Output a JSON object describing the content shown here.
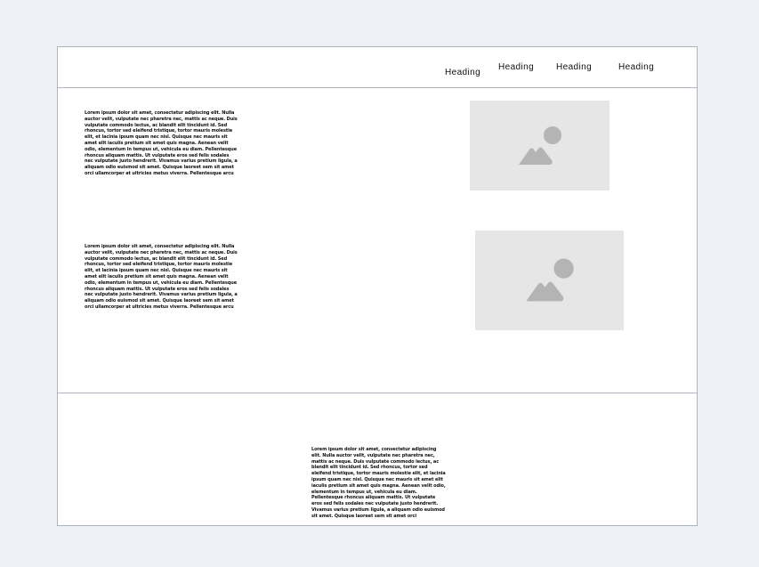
{
  "header": {
    "headings": [
      "Heading",
      "Heading",
      "Heading",
      "Heading"
    ]
  },
  "content": {
    "paragraph_1": "Lorem ipsum dolor sit amet, consectetur adipiscing elit. Nulla auctor velit, vulputate nec pharetra nec, mattis ac neque. Duis vulputate commodo lectus, ac blandit elit tincidunt id. Sed rhoncus, tortor sed eleifend tristique, tortor mauris molestie elit, et lacinia ipsum quam nec nisl. Quisque nec mauris sit amet elit iaculis pretium sit amet quis magna. Aenean velit odio, elementum in tempus ut, vehicula eu diam. Pellentesque rhoncus aliquam mattis. Ut vulputate eros sed felis sodales nec vulputate justo hendrerit. Vivamus varius pretium ligula, a aliquam odio euismod sit amet. Quisque laoreet sem sit amet orci ullamcorper at ultricies metus viverra. Pellentesque arcu mauris, malesuada quis ornare accumsan, blandit sed diam.",
    "paragraph_2": "Lorem ipsum dolor sit amet, consectetur adipiscing elit. Nulla auctor velit, vulputate nec pharetra nec, mattis ac neque. Duis vulputate commodo lectus, ac blandit elit tincidunt id. Sed rhoncus, tortor sed eleifend tristique, tortor mauris molestie elit, et lacinia ipsum quam nec nisl. Quisque nec mauris sit amet elit iaculis pretium sit amet quis magna. Aenean velit odio, elementum in tempus ut, vehicula eu diam. Pellentesque rhoncus aliquam mattis. Ut vulputate eros sed felis sodales nec vulputate justo hendrerit. Vivamus varius pretium ligula, a aliquam odio euismod sit amet. Quisque laoreet sem sit amet orci ullamcorper at ultricies metus viverra. Pellentesque arcu mauris, malesuada quis ornare accumsan, blandit sed diam."
  },
  "footer": {
    "paragraph": "Lorem ipsum dolor sit amet, consectetur adipiscing elit. Nulla auctor velit, vulputate nec pharetra nec, mattis ac neque. Duis vulputate commodo lectus, ac blandit elit tincidunt id. Sed rhoncus, tortor sed eleifend tristique, tortor mauris molestie elit, et lacinia ipsum quam nec nisl. Quisque nec mauris sit amet elit iaculis pretium sit amet quis magna. Aenean velit odio, elementum in tempus ut, vehicula eu diam. Pellentesque rhoncus aliquam mattis. Ut vulputate eros sed felis sodales nec vulputate justo hendrerit. Vivamus varius pretium ligula, a aliquam odio euismod sit amet. Quisque laoreet sem sit amet orci ullamcorper at ultricies metus viverra. Pellentesque arcu mauris, malesuada quis ornare accumsan, blandit sed diam."
  },
  "icons": {
    "image_placeholder": "image-placeholder-icon"
  },
  "colors": {
    "canvas_background": "#edf0f5",
    "page_background": "#ffffff",
    "border": "#aeb4bd",
    "placeholder_fill": "#e6e6e6",
    "placeholder_icon": "#b4b4b4"
  }
}
